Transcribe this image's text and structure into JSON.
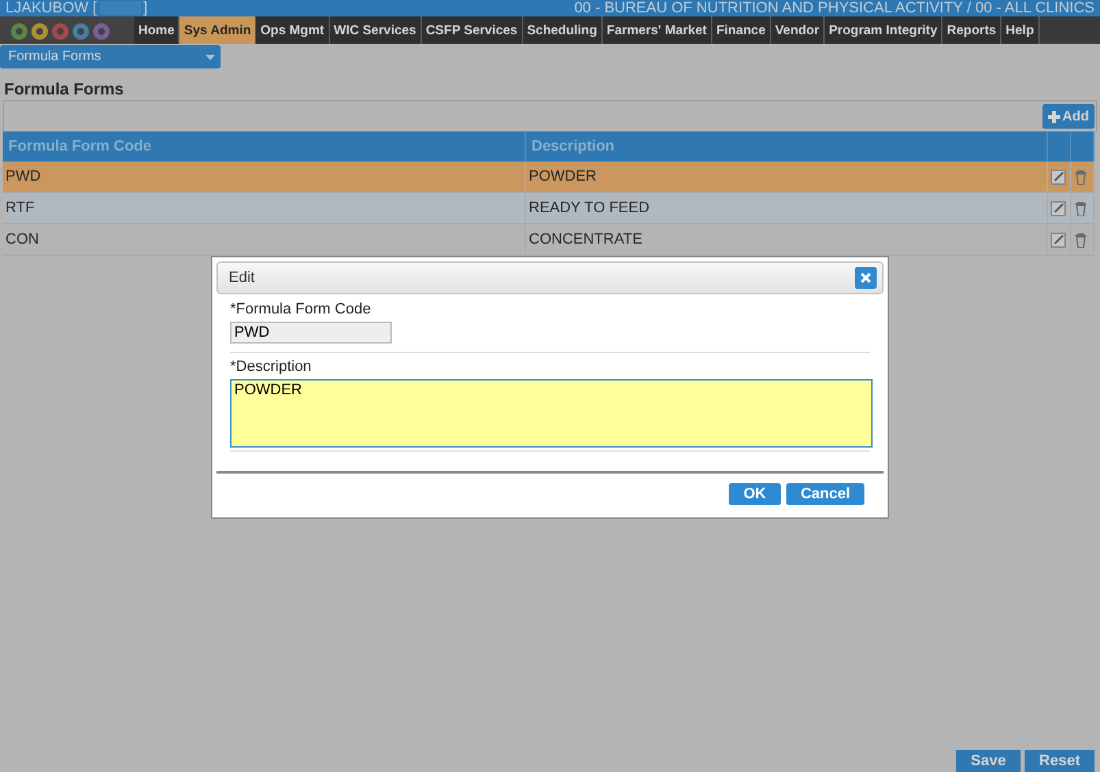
{
  "header": {
    "user": "LJAKUBOW [",
    "user_end": "]",
    "agency": "00 - BUREAU OF NUTRITION AND PHYSICAL ACTIVITY / 00 - ALL CLINICS"
  },
  "nav": [
    {
      "label": "Home",
      "selected": false
    },
    {
      "label": "Sys Admin",
      "selected": true
    },
    {
      "label": "Ops Mgmt",
      "selected": false
    },
    {
      "label": "WIC Services",
      "selected": false
    },
    {
      "label": "CSFP Services",
      "selected": false
    },
    {
      "label": "Scheduling",
      "selected": false
    },
    {
      "label": "Farmers' Market",
      "selected": false
    },
    {
      "label": "Finance",
      "selected": false
    },
    {
      "label": "Vendor",
      "selected": false
    },
    {
      "label": "Program Integrity",
      "selected": false
    },
    {
      "label": "Reports",
      "selected": false
    },
    {
      "label": "Help",
      "selected": false
    }
  ],
  "page_select": {
    "value": "Formula Forms"
  },
  "title": "Formula Forms",
  "add_button": "Add",
  "table": {
    "columns": [
      "Formula Form Code",
      "Description"
    ],
    "rows": [
      {
        "cells": [
          "PWD",
          "POWDER"
        ],
        "selected": true
      },
      {
        "cells": [
          "RTF",
          "READY TO FEED"
        ],
        "selected": false
      },
      {
        "cells": [
          "CON",
          "CONCENTRATE"
        ],
        "selected": false
      }
    ]
  },
  "footer_buttons": [
    "Save",
    "Reset"
  ],
  "dialog": {
    "title": "Edit",
    "code_label": "*Formula Form Code",
    "code_value": "PWD",
    "description_label": "*Description",
    "description_value": "POWDER",
    "buttons": [
      "OK",
      "Cancel"
    ]
  }
}
